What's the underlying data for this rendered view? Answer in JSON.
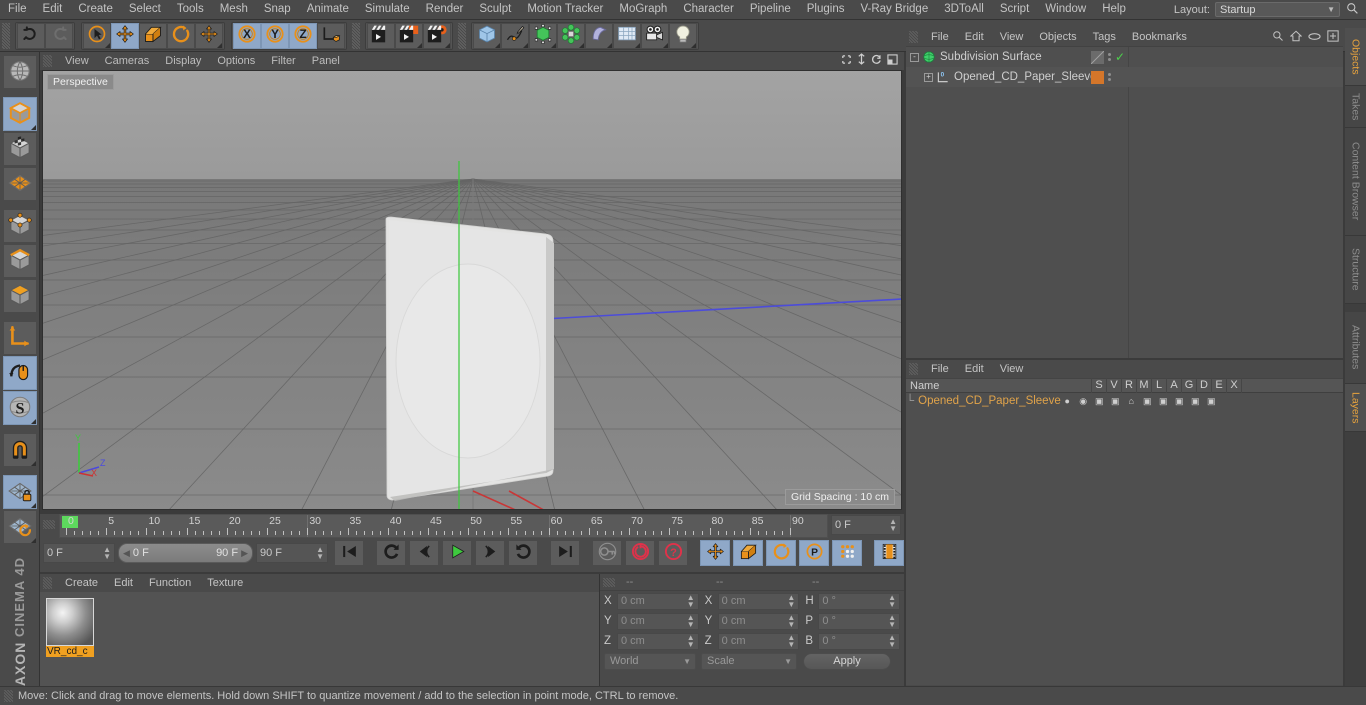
{
  "app": {
    "brand_top": "MAXON",
    "brand_bottom": "CINEMA 4D"
  },
  "menubar": {
    "items": [
      "File",
      "Edit",
      "Create",
      "Select",
      "Tools",
      "Mesh",
      "Snap",
      "Animate",
      "Simulate",
      "Render",
      "Sculpt",
      "Motion Tracker",
      "MoGraph",
      "Character",
      "Pipeline",
      "Plugins",
      "V-Ray Bridge",
      "3DToAll",
      "Script",
      "Window",
      "Help"
    ],
    "layout_label": "Layout:",
    "layout_value": "Startup",
    "search_icon": "search-icon"
  },
  "toolbar": {
    "groups": [
      {
        "name": "history",
        "buttons": [
          {
            "name": "undo-button",
            "icon": "undo-arrow-icon",
            "selected": false,
            "corner": false
          },
          {
            "name": "redo-button",
            "icon": "redo-arrow-icon",
            "selected": false,
            "corner": false
          }
        ]
      },
      {
        "name": "transform",
        "buttons": [
          {
            "name": "live-selection-button",
            "icon": "cursor-circle-icon",
            "selected": false,
            "corner": true
          },
          {
            "name": "move-tool-button",
            "icon": "move-arrows-icon",
            "selected": true,
            "corner": false
          },
          {
            "name": "scale-tool-button",
            "icon": "scale-box-icon",
            "selected": false,
            "corner": false
          },
          {
            "name": "rotate-tool-button",
            "icon": "rotate-circle-icon",
            "selected": false,
            "corner": false
          },
          {
            "name": "move-duplicate-button",
            "icon": "move-arrows-icon",
            "selected": false,
            "corner": true
          }
        ]
      },
      {
        "name": "axis-locks",
        "buttons": [
          {
            "name": "lock-x-axis-button",
            "icon": "x-axis-icon",
            "selected": true,
            "corner": false
          },
          {
            "name": "lock-y-axis-button",
            "icon": "y-axis-icon",
            "selected": true,
            "corner": false
          },
          {
            "name": "lock-z-axis-button",
            "icon": "z-axis-icon",
            "selected": true,
            "corner": false
          },
          {
            "name": "world-object-coords-button",
            "icon": "axis-cube-icon",
            "selected": false,
            "corner": false
          }
        ]
      },
      {
        "name": "render",
        "buttons": [
          {
            "name": "render-view-button",
            "icon": "clapperboard-icon",
            "selected": false,
            "corner": false
          },
          {
            "name": "render-to-picture-viewer-button",
            "icon": "clapperboard-pv-icon",
            "selected": false,
            "corner": true
          },
          {
            "name": "render-settings-button",
            "icon": "clapperboard-gear-icon",
            "selected": false,
            "corner": true
          }
        ]
      },
      {
        "name": "create",
        "buttons": [
          {
            "name": "add-cube-button",
            "icon": "blue-cube-icon",
            "selected": false,
            "corner": true
          },
          {
            "name": "add-spline-button",
            "icon": "pen-spline-icon",
            "selected": false,
            "corner": true
          },
          {
            "name": "add-generator-button",
            "icon": "green-nurbs-cube-icon",
            "selected": false,
            "corner": true
          },
          {
            "name": "add-array-button",
            "icon": "green-cluster-icon",
            "selected": false,
            "corner": true
          },
          {
            "name": "add-deformer-button",
            "icon": "bend-deformer-icon",
            "selected": false,
            "corner": true
          },
          {
            "name": "add-floor-button",
            "icon": "floor-grid-icon",
            "selected": false,
            "corner": true
          },
          {
            "name": "add-camera-button",
            "icon": "camera-icon",
            "selected": false,
            "corner": true
          },
          {
            "name": "add-light-button",
            "icon": "light-bulb-icon",
            "selected": false,
            "corner": true
          }
        ]
      }
    ]
  },
  "left_toolbar": {
    "groups": [
      [
        {
          "name": "undo-view-button",
          "icon": "globe-wire-icon",
          "selected": false,
          "corner": false
        }
      ],
      [
        {
          "name": "model-mode-button",
          "icon": "model-cube-icon",
          "selected": true,
          "corner": true
        },
        {
          "name": "texture-mode-button",
          "icon": "texture-cube-icon",
          "selected": false,
          "corner": false
        },
        {
          "name": "workplane-mode-button",
          "icon": "workplane-grid-icon",
          "selected": false,
          "corner": false
        }
      ],
      [
        {
          "name": "points-mode-button",
          "icon": "points-cube-icon",
          "selected": false,
          "corner": false
        },
        {
          "name": "edges-mode-button",
          "icon": "edges-cube-icon",
          "selected": false,
          "corner": false
        },
        {
          "name": "polygons-mode-button",
          "icon": "polygons-cube-icon",
          "selected": false,
          "corner": false
        }
      ],
      [
        {
          "name": "object-axis-mode-button",
          "icon": "axis-corner-icon",
          "selected": false,
          "corner": false
        },
        {
          "name": "enable-axis-modification-button",
          "icon": "mouse-axis-icon",
          "selected": true,
          "corner": false
        },
        {
          "name": "soft-selection-button",
          "icon": "soft-selection-s-icon",
          "selected": true,
          "corner": true
        }
      ],
      [
        {
          "name": "snap-magnet-button",
          "icon": "magnet-icon",
          "selected": false,
          "corner": true
        }
      ],
      [
        {
          "name": "lock-workplane-button",
          "icon": "workplane-lock-icon",
          "selected": true,
          "corner": true
        },
        {
          "name": "planar-workplane-button",
          "icon": "workplane-rotate-icon",
          "selected": false,
          "corner": true
        }
      ]
    ]
  },
  "viewport": {
    "menu": [
      "View",
      "Cameras",
      "Display",
      "Options",
      "Filter",
      "Panel"
    ],
    "nav_icons": [
      "pan-icon",
      "dolly-icon",
      "rotate-view-icon",
      "maximize-view-icon"
    ],
    "camera_label": "Perspective",
    "grid_spacing": "Grid Spacing : 10 cm",
    "axis_labels": {
      "x": "X",
      "y": "Y",
      "z": "Z"
    },
    "object_description": "white opened CD paper sleeve standing vertically with circular CD cutout"
  },
  "timeline": {
    "frame_labels": [
      "0",
      "5",
      "10",
      "15",
      "20",
      "25",
      "30",
      "35",
      "40",
      "45",
      "50",
      "55",
      "60",
      "65",
      "70",
      "75",
      "80",
      "85",
      "90"
    ],
    "current_frame_field": "0 F",
    "range_start": "0 F",
    "range_end": "90 F",
    "max_frame_field": "90 F",
    "preview_frame_field": "0 F",
    "controls": [
      {
        "name": "go-to-start-button",
        "icon": "skip-start-icon",
        "selected": false
      },
      {
        "name": "play-backwards-button",
        "icon": "loop-back-icon",
        "selected": false
      },
      {
        "name": "step-back-button",
        "icon": "step-back-icon",
        "selected": false
      },
      {
        "name": "play-button",
        "icon": "play-icon",
        "selected": false
      },
      {
        "name": "step-forward-button",
        "icon": "step-forward-icon",
        "selected": false
      },
      {
        "name": "loop-button",
        "icon": "loop-forward-icon",
        "selected": false
      },
      {
        "name": "go-to-end-button",
        "icon": "skip-end-icon",
        "selected": false
      },
      {
        "name": "record-keyframe-button",
        "icon": "key-icon",
        "selected": false
      },
      {
        "name": "autokey-button",
        "icon": "autokey-circle-icon",
        "selected": false
      },
      {
        "name": "keyframe-selection-button",
        "icon": "question-circle-icon",
        "selected": false
      },
      {
        "name": "position-key-button",
        "icon": "move-key-icon",
        "selected": true
      },
      {
        "name": "scale-key-button",
        "icon": "scale-key-icon",
        "selected": true
      },
      {
        "name": "rotation-key-button",
        "icon": "rotate-key-icon",
        "selected": true
      },
      {
        "name": "parameter-key-button",
        "icon": "param-p-icon",
        "selected": true
      },
      {
        "name": "point-level-animation-button",
        "icon": "dots-grid-icon",
        "selected": true
      },
      {
        "name": "timeline-toggle-button",
        "icon": "filmstrip-icon",
        "selected": true
      }
    ]
  },
  "material_manager": {
    "menu": [
      "Create",
      "Edit",
      "Function",
      "Texture"
    ],
    "materials": [
      {
        "name": "VR_cd_c",
        "selected": true
      }
    ]
  },
  "coordinates": {
    "header": [
      "--",
      "--",
      "--"
    ],
    "rows": [
      {
        "pos_label": "X",
        "pos_value": "0 cm",
        "size_label": "X",
        "size_value": "0 cm",
        "rot_label": "H",
        "rot_value": "0 °"
      },
      {
        "pos_label": "Y",
        "pos_value": "0 cm",
        "size_label": "Y",
        "size_value": "0 cm",
        "rot_label": "P",
        "rot_value": "0 °"
      },
      {
        "pos_label": "Z",
        "pos_value": "0 cm",
        "size_label": "Z",
        "size_value": "0 cm",
        "rot_label": "B",
        "rot_value": "0 °"
      }
    ],
    "system_dropdown": "World",
    "mode_dropdown": "Scale",
    "apply_label": "Apply"
  },
  "object_manager": {
    "menu": [
      "File",
      "Edit",
      "View",
      "Objects",
      "Tags",
      "Bookmarks"
    ],
    "icons": [
      "search-icon",
      "home-icon",
      "ellipse-icon",
      "plus-box-icon"
    ],
    "items": [
      {
        "name": "Subdivision Surface",
        "icon": "subdivision-surface-icon",
        "indent": 0,
        "expander": "-",
        "tag_color": "#7a7a7a",
        "check": true
      },
      {
        "name": "Opened_CD_Paper_Sleeve",
        "icon": "polygon-object-icon",
        "indent": 1,
        "expander": "+",
        "tag_color": "#d4762a",
        "check": false
      }
    ]
  },
  "layer_manager": {
    "menu": [
      "File",
      "Edit",
      "View"
    ],
    "columns": [
      "Name",
      "S",
      "V",
      "R",
      "M",
      "L",
      "A",
      "G",
      "D",
      "E",
      "X"
    ],
    "rows": [
      {
        "name": "Opened_CD_Paper_Sleeve",
        "color": "#d4762a"
      }
    ]
  },
  "right_tabs": [
    {
      "label": "Objects",
      "active": true
    },
    {
      "label": "Takes",
      "active": false
    },
    {
      "label": "Content Browser",
      "active": false
    },
    {
      "label": "Structure",
      "active": false
    }
  ],
  "right_tabs_lower": [
    {
      "label": "Attributes",
      "active": false
    },
    {
      "label": "Layers",
      "active": true
    }
  ],
  "statusbar": {
    "text": "Move: Click and drag to move elements. Hold down SHIFT to quantize movement / add to the selection in point mode, CTRL to remove."
  },
  "colors": {
    "accent_orange": "#e8901a",
    "selected_blue": "#8fa8c8",
    "layer_orange": "#e0a34a",
    "panel_bg": "#4a4a4a",
    "axis_x": "#cc3333",
    "axis_y": "#33bb33",
    "axis_z": "#4a4adf"
  }
}
